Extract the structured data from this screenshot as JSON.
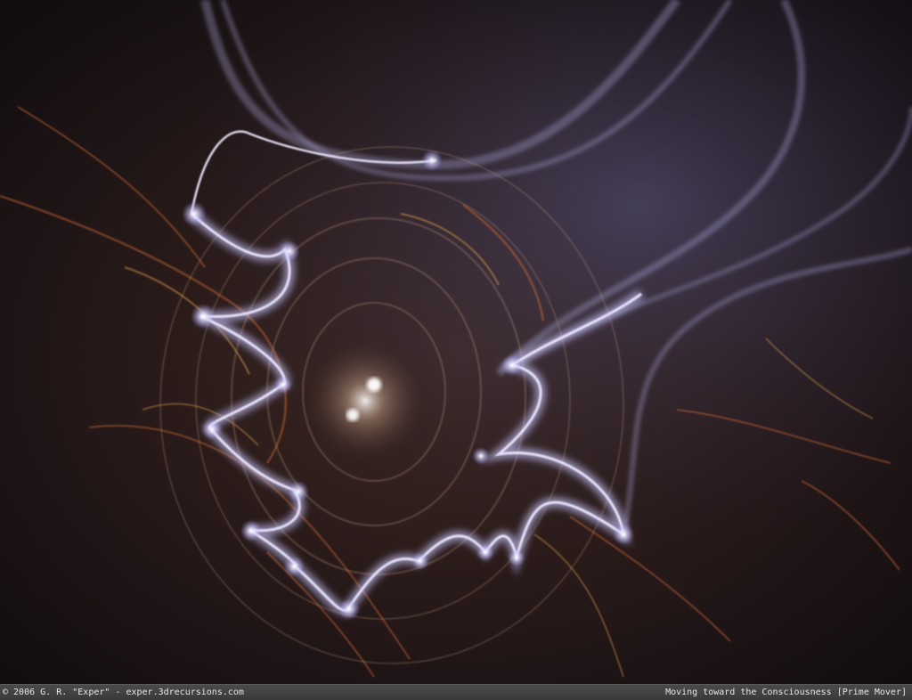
{
  "caption": {
    "copyright": "© 2006 G. R. \"Exper\" - exper.3drecursions.com",
    "title": "Moving toward the Consciousness [Prime Mover]"
  },
  "artwork": {
    "description_colors": {
      "background": "#1b1214",
      "glow": "#e8e6ff",
      "lavender": "#b8b6e8",
      "orange": "#e07a3a",
      "amber": "#f0b050"
    }
  }
}
